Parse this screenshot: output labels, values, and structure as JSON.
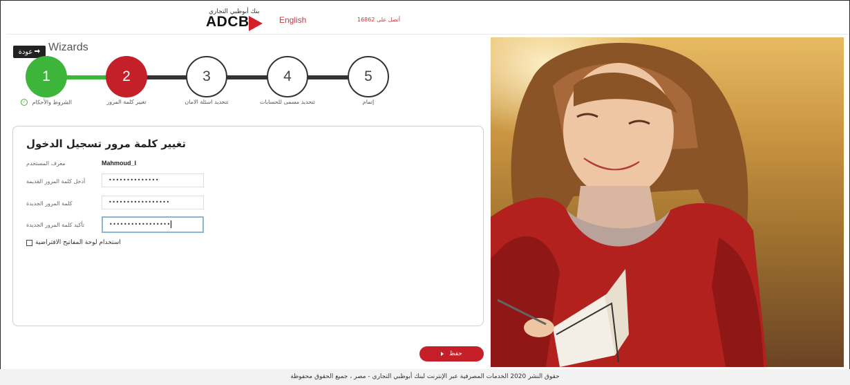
{
  "header": {
    "logo_arabic": "بنك أبوظبي التجاري",
    "logo_text": "ADCB",
    "language_link": "English",
    "contact_text": "أتصل على 16862"
  },
  "nav": {
    "back_label": "عودة",
    "page_title": "Wizards"
  },
  "wizard": {
    "steps": [
      {
        "number": "1",
        "label": "الشروط والأحكام",
        "state": "done"
      },
      {
        "number": "2",
        "label": "تغيير كلمة المرور",
        "state": "active"
      },
      {
        "number": "3",
        "label": "تتحديد اسئلة الامان",
        "state": "pending"
      },
      {
        "number": "4",
        "label": "تتحديد مسمى للحسابات",
        "state": "pending"
      },
      {
        "number": "5",
        "label": "إتمام",
        "state": "pending"
      }
    ]
  },
  "form": {
    "title": "تغيير كلمة مرور تسجيل الدخول",
    "username_label": "معرف المستخدم",
    "username_value": "Mahmoud_I",
    "old_password_label": "أدخل كلمة المرور القديمة",
    "old_password_value": "••••••••••••••",
    "new_password_label": "كلمة المرور الجديدة",
    "new_password_value": "•••••••••••••••••",
    "confirm_password_label": "تأكيد كلمة المرور الجديدة",
    "confirm_password_value": "•••••••••••••••••",
    "virtual_keyboard_label": "استخدام لوحة المفاتيح الافتراضية"
  },
  "actions": {
    "save_label": "حفظ"
  },
  "footer": {
    "copyright": "حقوق النشر 2020 الخدمات المصرفية عبر الإنترنت لبنك أبوظبي التجاري - مصر ، جميع الحقوق محفوظة"
  },
  "colors": {
    "brand_red": "#c51f2a",
    "done_green": "#3db53a"
  },
  "icons": {
    "back": "arrow-right-icon",
    "step_done": "check-circle-icon",
    "save": "play-arrow-icon"
  }
}
